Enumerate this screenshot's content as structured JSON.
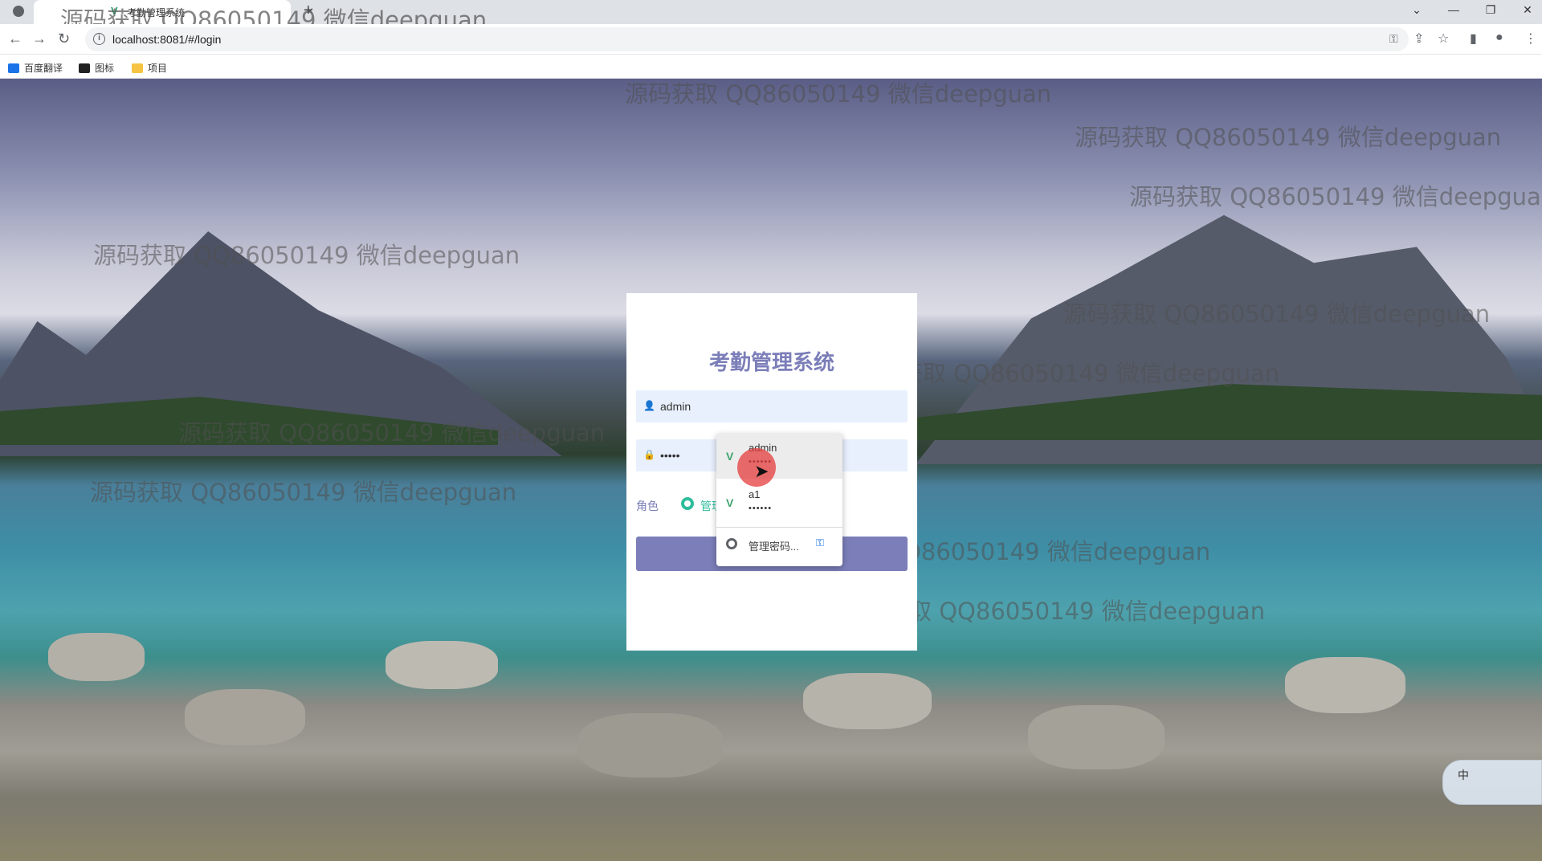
{
  "browser": {
    "tab_title": "考勤管理系统",
    "tab_close": "×",
    "new_tab": "+",
    "url": "localhost:8081/#/login",
    "info_glyph": "i",
    "window_controls": [
      "⌄",
      "—",
      "❐",
      "✕"
    ]
  },
  "bookmarks": [
    {
      "label": "百度翻译",
      "icon": "translate-icon",
      "color": "#1a73e8"
    },
    {
      "label": "图标",
      "icon": "image-icon",
      "color": "#222222"
    },
    {
      "label": "项目",
      "icon": "folder-icon",
      "color": "#f6c343"
    }
  ],
  "watermarks": {
    "text": "源码获取 QQ86050149 微信deepguan",
    "tab_text": "源码获取 QQ86050149 微信deepguan"
  },
  "login": {
    "title": "考勤管理系统",
    "username_value": "admin",
    "password_value": "•••••",
    "role_label": "角色",
    "role_option": "管理"
  },
  "autofill": {
    "entries": [
      {
        "username": "admin",
        "password": "••••••"
      },
      {
        "username": "a1",
        "password": "••••••"
      }
    ],
    "manage_label": "管理密码..."
  },
  "ime": {
    "label": "中"
  },
  "colors": {
    "accent": "#7b7eb8",
    "radio": "#2ebd9c",
    "field_bg": "#e8f0fe"
  }
}
